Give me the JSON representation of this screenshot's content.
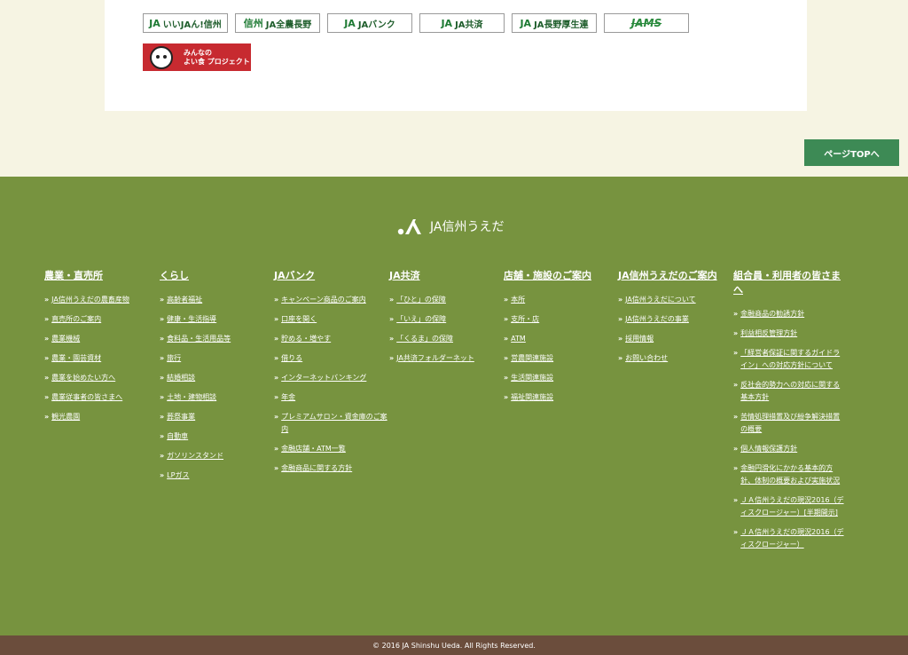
{
  "banners": [
    {
      "label": "いいJAん!信州",
      "mark": "JA"
    },
    {
      "label": "JA全農長野",
      "mark": "信州"
    },
    {
      "label": "JAバンク",
      "mark": "JA"
    },
    {
      "label": "JA共済",
      "mark": "JA"
    },
    {
      "label": "JA長野厚生連",
      "mark": "JA"
    },
    {
      "label": "JAMS",
      "mark": ""
    }
  ],
  "red_banner": {
    "line1": "みんなの",
    "line2": "よい食 プロジェクト"
  },
  "page_top": "ページTOPへ",
  "logo_text": "JA信州うえだ",
  "columns": [
    {
      "title": "農業・直売所",
      "items": [
        "JA信州うえだの農畜産物",
        "直売所のご案内",
        "農業機械",
        "農業・園芸資材",
        "農業を始めたい方へ",
        "農業従事者の皆さまへ",
        "観光農園"
      ]
    },
    {
      "title": "くらし",
      "items": [
        "高齢者福祉",
        "健康・生活指導",
        "食料品・生活用品等",
        "旅行",
        "結婚相談",
        "土地・建物相談",
        "葬祭事業",
        "自動車",
        "ガソリンスタンド",
        "LPガス"
      ]
    },
    {
      "title": "JAバンク",
      "items": [
        "キャンペーン商品のご案内",
        "口座を開く",
        "貯める・増やす",
        "借りる",
        "インターネットバンキング",
        "年金",
        "プレミアムサロン・資金庫のご案内",
        "金融店舗・ATM一覧",
        "金融商品に関する方針"
      ]
    },
    {
      "title": "JA共済",
      "items": [
        "「ひと」の保障",
        "「いえ」の保障",
        "「くるま」の保障",
        "JA共済フォルダーネット"
      ]
    },
    {
      "title": "店舗・施設のご案内",
      "items": [
        "本所",
        "支所・店",
        "ATM",
        "営農関連施設",
        "生活関連施設",
        "福祉関連施設"
      ]
    },
    {
      "title": "JA信州うえだのご案内",
      "items": [
        "JA信州うえだについて",
        "JA信州うえだの事業",
        "採用情報",
        "お問い合わせ"
      ]
    },
    {
      "title": "組合員・利用者の皆さまへ",
      "items": [
        "金融商品の勧誘方針",
        "利益相反管理方針",
        "「経営者保証に関するガイドライン」への対応方針について",
        "反社会的勢力への対応に関する基本方針",
        "苦情処理措置及び紛争解決措置の概要",
        "個人情報保護方針",
        "金融円滑化にかかる基本的方針、体制の概要および実施状況",
        "ＪＡ信州うえだの現況2016（ディスクロージャー）[半期開示]",
        "ＪＡ信州うえだの現況2016（ディスクロージャー）"
      ]
    }
  ],
  "copyright": "© 2016 JA Shinshu Ueda. All Rights Reserved."
}
